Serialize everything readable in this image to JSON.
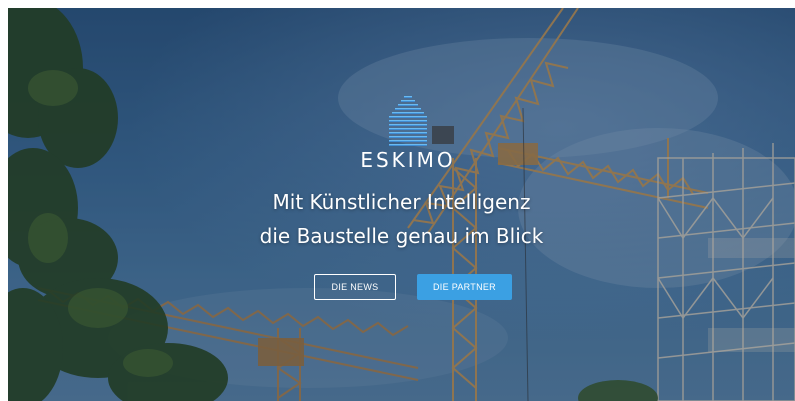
{
  "brand": {
    "name": "ESKIMO",
    "logo_icon": "stacked-lines-house-icon",
    "accent": "#3ba0e3"
  },
  "hero": {
    "headline_line1": "Mit Künstlicher Intelligenz",
    "headline_line2": "die Baustelle genau im Blick",
    "background": "construction-cranes-photo"
  },
  "buttons": {
    "news_label": "DIE NEWS",
    "partner_label": "DIE PARTNER"
  }
}
